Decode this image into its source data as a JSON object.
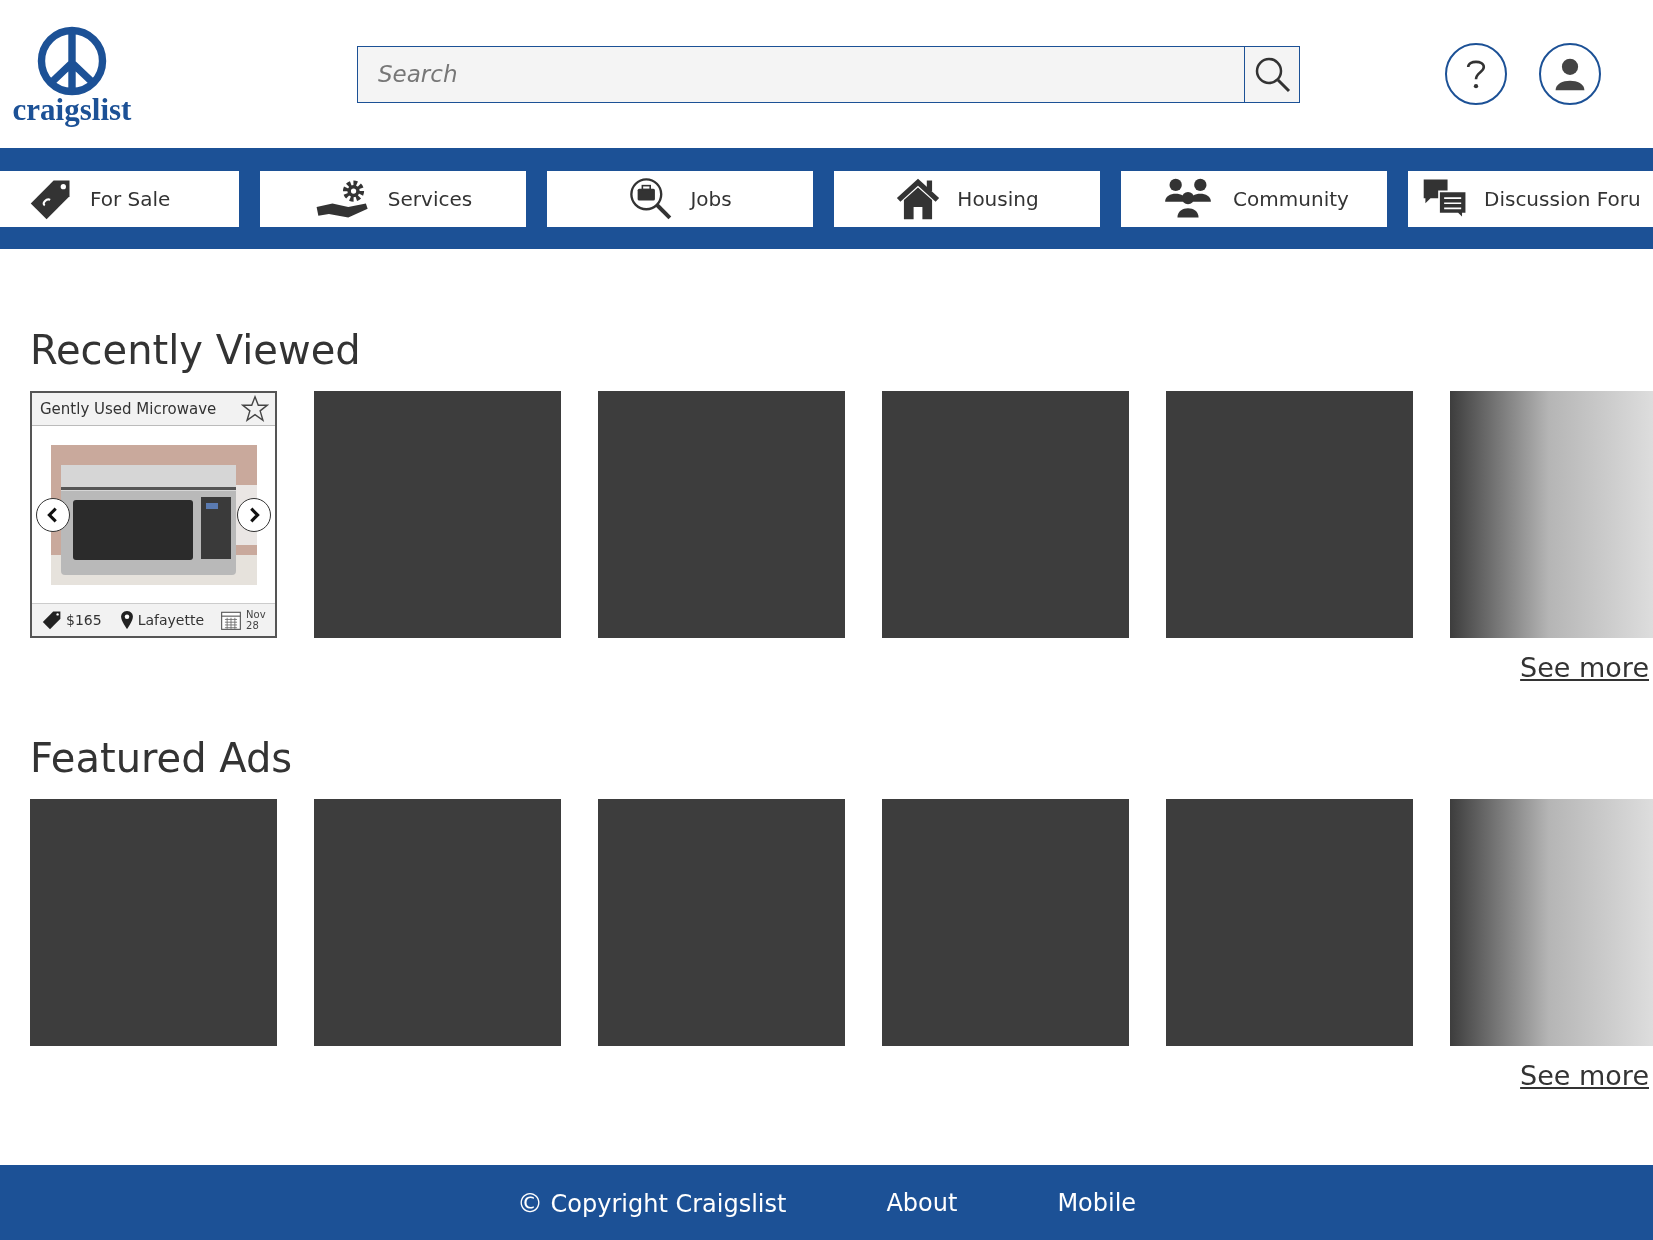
{
  "logo": {
    "text": "craigslist"
  },
  "search": {
    "placeholder": "Search"
  },
  "nav": [
    {
      "label": "For Sale"
    },
    {
      "label": "Services"
    },
    {
      "label": "Jobs"
    },
    {
      "label": "Housing"
    },
    {
      "label": "Community"
    },
    {
      "label": "Discussion Foru"
    }
  ],
  "sections": [
    {
      "title": "Recently Viewed",
      "link": "See more",
      "items": [
        {
          "kind": "listing",
          "title": "Gently Used Microwave",
          "price": "$165",
          "location": "Lafayette",
          "month": "Nov",
          "day": "28",
          "starred": false
        },
        {
          "kind": "placeholder"
        },
        {
          "kind": "placeholder"
        },
        {
          "kind": "placeholder"
        },
        {
          "kind": "placeholder"
        },
        {
          "kind": "fade"
        }
      ]
    },
    {
      "title": "Featured Ads",
      "link": "See more",
      "items": [
        {
          "kind": "placeholder"
        },
        {
          "kind": "placeholder"
        },
        {
          "kind": "placeholder"
        },
        {
          "kind": "placeholder"
        },
        {
          "kind": "placeholder"
        },
        {
          "kind": "fade"
        }
      ]
    }
  ],
  "footer": {
    "copyright_symbol": "©",
    "copyright": "Copyright Craigslist",
    "links": [
      "About",
      "Mobile"
    ]
  }
}
